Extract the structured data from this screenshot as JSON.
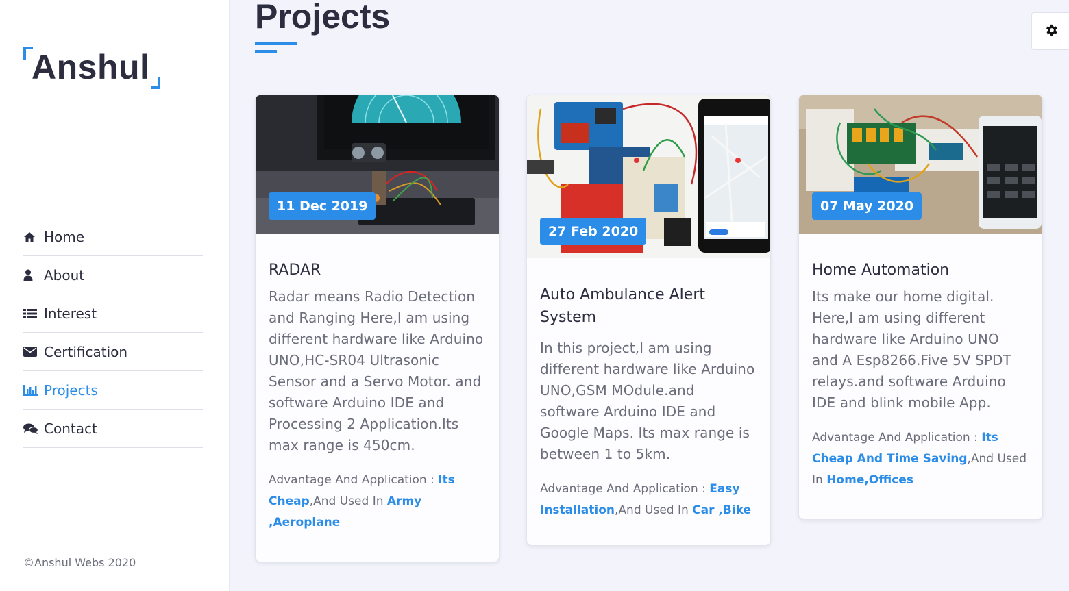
{
  "brand": {
    "logo_text": "Anshul",
    "accent": "#2b8de8"
  },
  "nav": [
    {
      "label": "Home",
      "icon": "home-icon"
    },
    {
      "label": "About",
      "icon": "user-icon"
    },
    {
      "label": "Interest",
      "icon": "list-icon"
    },
    {
      "label": "Certification",
      "icon": "envelope-icon"
    },
    {
      "label": "Projects",
      "icon": "bar-chart-icon",
      "active": true
    },
    {
      "label": "Contact",
      "icon": "chat-icon"
    }
  ],
  "footer": {
    "copyright": "©Anshul Webs 2020"
  },
  "page": {
    "title": "Projects"
  },
  "projects": [
    {
      "date": "11 Dec 2019",
      "title": "RADAR",
      "description": "Radar means Radio Detection and Ranging Here,I am using different hardware like Arduino UNO,HC-SR04 Ultrasonic Sensor and a Servo Motor. and software Arduino IDE and Processing 2 Application.Its max range is 450cm.",
      "adv_label": "Advantage And Application : ",
      "adv_highlight": "Its Cheap",
      "adv_mid": ",And Used In ",
      "adv_uses": "Army ,Aeroplane"
    },
    {
      "date": "27 Feb 2020",
      "title": "Auto Ambulance Alert System",
      "description": "In this project,I am using different hardware like Arduino UNO,GSM MOdule.and software Arduino IDE and Google Maps. Its max range is between 1 to 5km.",
      "adv_label": "Advantage And Application : ",
      "adv_highlight": "Easy Installation",
      "adv_mid": ",And Used In ",
      "adv_uses": "Car ,Bike"
    },
    {
      "date": "07 May 2020",
      "title": "Home Automation",
      "description": "Its make our home digital. Here,I am using different hardware like Arduino UNO and A Esp8266.Five 5V SPDT relays.and software Arduino IDE and blink mobile App.",
      "adv_label": "Advantage And Application : ",
      "adv_highlight": "Its Cheap And Time Saving",
      "adv_mid": ",And Used In ",
      "adv_uses": "Home,Offices"
    }
  ]
}
